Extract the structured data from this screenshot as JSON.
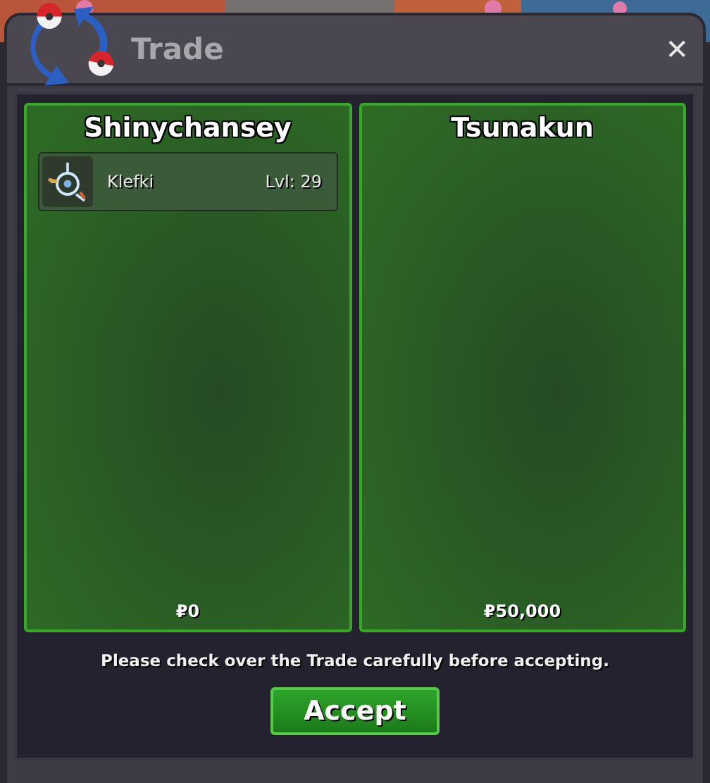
{
  "window": {
    "title": "Trade",
    "close": "✕"
  },
  "offers": [
    {
      "player": "Shinychansey",
      "pokemon": [
        {
          "name": "Klefki",
          "level": "Lvl: 29"
        }
      ],
      "money": "₽0"
    },
    {
      "player": "Tsunakun",
      "money": "₽50,000"
    }
  ],
  "message": "Please check over the Trade carefully before accepting.",
  "buttons": [
    "Accept"
  ]
}
